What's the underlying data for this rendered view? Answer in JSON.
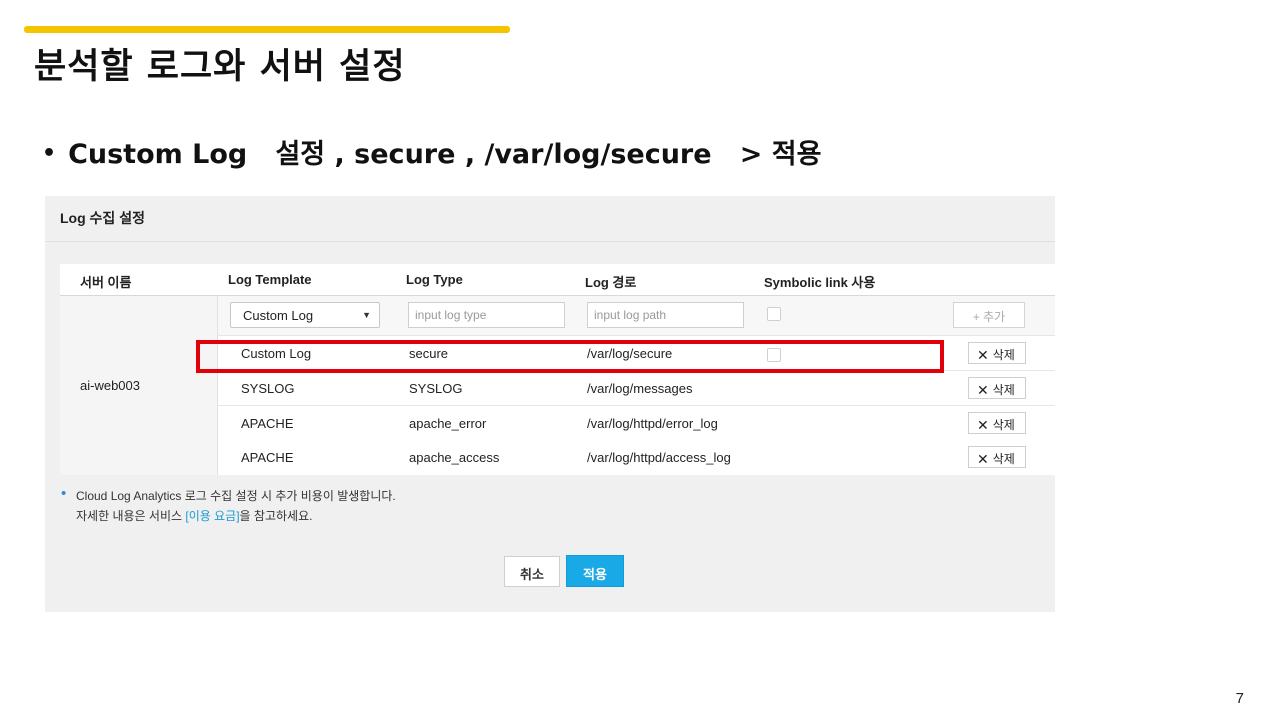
{
  "slide": {
    "title": "분석할 로그와 서버 설정",
    "bullet": "Custom Log   설정 , secure , /var/log/secure   > 적용",
    "page_number": "7",
    "accent_color": "#f5c400",
    "highlight_color": "#e0000a"
  },
  "panel": {
    "title": "Log 수집 설정",
    "columns": {
      "server_name": "서버 이름",
      "log_template": "Log Template",
      "log_type": "Log Type",
      "log_path": "Log 경로",
      "symbolic_link": "Symbolic link 사용"
    },
    "server_name": "ai-web003",
    "input_row": {
      "template_selected": "Custom Log",
      "log_type_placeholder": "input log type",
      "log_path_placeholder": "input log path",
      "add_button": "추가",
      "add_icon": "plus-icon"
    },
    "rows": [
      {
        "template": "Custom Log",
        "type": "secure",
        "path": "/var/log/secure",
        "delete": "삭제"
      },
      {
        "template": "SYSLOG",
        "type": "SYSLOG",
        "path": "/var/log/messages",
        "delete": "삭제"
      },
      {
        "template": "APACHE",
        "type": "apache_error",
        "path": "/var/log/httpd/error_log",
        "delete": "삭제"
      },
      {
        "template": "APACHE",
        "type": "apache_access",
        "path": "/var/log/httpd/access_log",
        "delete": "삭제"
      }
    ],
    "notice": {
      "line1": "Cloud Log Analytics 로그 수집 설정 시 추가 비용이 발생합니다.",
      "line2_before": "자세한 내용은 서비스 ",
      "line2_link": "[이용 요금]",
      "line2_after": "을 참고하세요."
    },
    "buttons": {
      "cancel": "취소",
      "apply": "적용",
      "apply_color": "#18a9e6"
    }
  }
}
